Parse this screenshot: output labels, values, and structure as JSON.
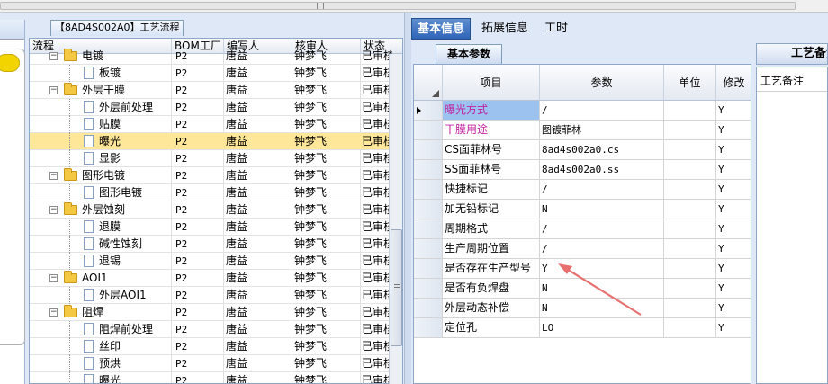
{
  "window": {
    "title": "【8AD4S002A0】工艺流程"
  },
  "left_grid": {
    "columns": [
      "流程",
      "BOM工厂",
      "编写人",
      "核审人",
      "状态"
    ],
    "rows": [
      {
        "name": "电镀",
        "level": 1,
        "type": "folder",
        "bom": "P2",
        "writer": "唐益",
        "reviewer": "钟梦飞",
        "status": "已审核"
      },
      {
        "name": "板镀",
        "level": 2,
        "type": "doc",
        "bom": "P2",
        "writer": "唐益",
        "reviewer": "钟梦飞",
        "status": "已审核"
      },
      {
        "name": "外层干膜",
        "level": 1,
        "type": "folder",
        "bom": "P2",
        "writer": "唐益",
        "reviewer": "钟梦飞",
        "status": "已审核"
      },
      {
        "name": "外层前处理",
        "level": 2,
        "type": "doc",
        "bom": "P2",
        "writer": "唐益",
        "reviewer": "钟梦飞",
        "status": "已审核"
      },
      {
        "name": "贴膜",
        "level": 2,
        "type": "doc",
        "bom": "P2",
        "writer": "唐益",
        "reviewer": "钟梦飞",
        "status": "已审核"
      },
      {
        "name": "曝光",
        "level": 2,
        "type": "doc",
        "bom": "P2",
        "writer": "唐益",
        "reviewer": "钟梦飞",
        "status": "已审核",
        "selected": true
      },
      {
        "name": "显影",
        "level": 2,
        "type": "doc",
        "bom": "P2",
        "writer": "唐益",
        "reviewer": "钟梦飞",
        "status": "已审核"
      },
      {
        "name": "图形电镀",
        "level": 1,
        "type": "folder",
        "bom": "P2",
        "writer": "唐益",
        "reviewer": "钟梦飞",
        "status": "已审核"
      },
      {
        "name": "图形电镀",
        "level": 2,
        "type": "doc",
        "bom": "P2",
        "writer": "唐益",
        "reviewer": "钟梦飞",
        "status": "已审核"
      },
      {
        "name": "外层蚀刻",
        "level": 1,
        "type": "folder",
        "bom": "P2",
        "writer": "唐益",
        "reviewer": "钟梦飞",
        "status": "已审核"
      },
      {
        "name": "退膜",
        "level": 2,
        "type": "doc",
        "bom": "P2",
        "writer": "唐益",
        "reviewer": "钟梦飞",
        "status": "已审核"
      },
      {
        "name": "碱性蚀刻",
        "level": 2,
        "type": "doc",
        "bom": "P2",
        "writer": "唐益",
        "reviewer": "钟梦飞",
        "status": "已审核"
      },
      {
        "name": "退锡",
        "level": 2,
        "type": "doc",
        "bom": "P2",
        "writer": "唐益",
        "reviewer": "钟梦飞",
        "status": "已审核"
      },
      {
        "name": "AOI1",
        "level": 1,
        "type": "folder",
        "bom": "P2",
        "writer": "唐益",
        "reviewer": "钟梦飞",
        "status": "已审核"
      },
      {
        "name": "外层AOI1",
        "level": 2,
        "type": "doc",
        "bom": "P2",
        "writer": "唐益",
        "reviewer": "钟梦飞",
        "status": "已审核"
      },
      {
        "name": "阻焊",
        "level": 1,
        "type": "folder",
        "bom": "P2",
        "writer": "唐益",
        "reviewer": "钟梦飞",
        "status": "已审核"
      },
      {
        "name": "阻焊前处理",
        "level": 2,
        "type": "doc",
        "bom": "P2",
        "writer": "唐益",
        "reviewer": "钟梦飞",
        "status": "已审核"
      },
      {
        "name": "丝印",
        "level": 2,
        "type": "doc",
        "bom": "P2",
        "writer": "唐益",
        "reviewer": "钟梦飞",
        "status": "已审核"
      },
      {
        "name": "预烘",
        "level": 2,
        "type": "doc",
        "bom": "P2",
        "writer": "唐益",
        "reviewer": "钟梦飞",
        "status": "已审核"
      },
      {
        "name": "曝光",
        "level": 2,
        "type": "doc",
        "bom": "P2",
        "writer": "唐益",
        "reviewer": "钟梦飞",
        "status": "已审核"
      }
    ]
  },
  "right_tabs": [
    {
      "label": "基本信息",
      "active": true
    },
    {
      "label": "拓展信息",
      "active": false
    },
    {
      "label": "工时",
      "active": false
    }
  ],
  "sub_tab": "基本参数",
  "param_grid": {
    "columns": [
      "项目",
      "参数",
      "单位",
      "修改"
    ],
    "rows": [
      {
        "item": "曝光方式",
        "value": "/",
        "unit": "",
        "mod": "Y",
        "pink": true,
        "current": true
      },
      {
        "item": "干膜用途",
        "value": "图镀菲林",
        "unit": "",
        "mod": "Y",
        "pink": true
      },
      {
        "item": "CS面菲林号",
        "value": "8ad4s002a0.cs",
        "unit": "",
        "mod": "Y"
      },
      {
        "item": "SS面菲林号",
        "value": "8ad4s002a0.ss",
        "unit": "",
        "mod": "Y"
      },
      {
        "item": "快捷标记",
        "value": "/",
        "unit": "",
        "mod": "Y"
      },
      {
        "item": "加无铅标记",
        "value": "N",
        "unit": "",
        "mod": "Y"
      },
      {
        "item": "周期格式",
        "value": "/",
        "unit": "",
        "mod": "Y"
      },
      {
        "item": "生产周期位置",
        "value": "/",
        "unit": "",
        "mod": "Y"
      },
      {
        "item": "是否存在生产型号",
        "value": "Y",
        "unit": "",
        "mod": "Y"
      },
      {
        "item": "是否有负焊盘",
        "value": "N",
        "unit": "",
        "mod": "Y"
      },
      {
        "item": "外层动态补偿",
        "value": "N",
        "unit": "",
        "mod": "Y"
      },
      {
        "item": "定位孔",
        "value": "LO",
        "unit": "",
        "mod": "Y"
      }
    ]
  },
  "far_panel": {
    "title": "工艺备注",
    "label": "工艺备注"
  },
  "colors": {
    "selected_row": "#ffe79a",
    "pink_text": "#c020a0",
    "arrow": "#e87070",
    "tab_active": "#2f64b8"
  }
}
